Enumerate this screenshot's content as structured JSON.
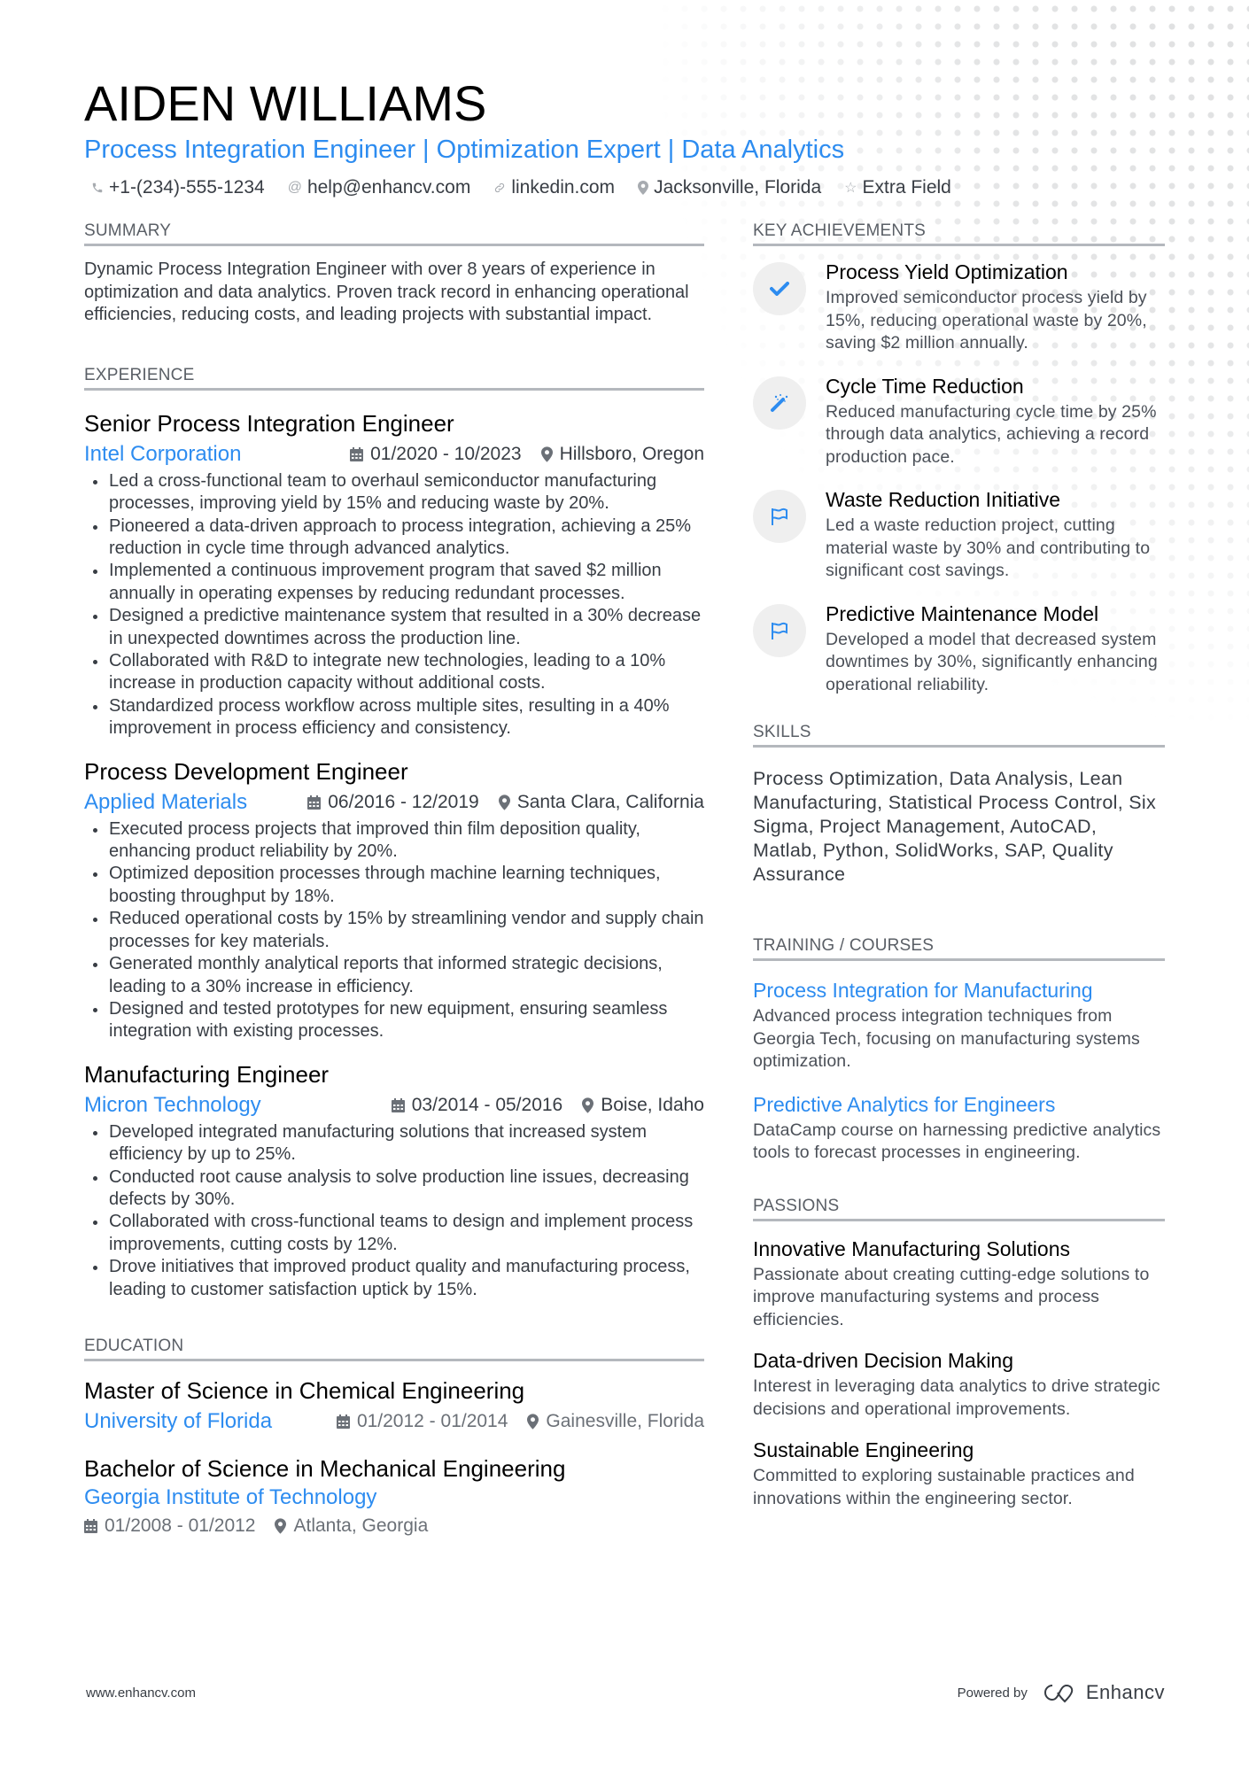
{
  "header": {
    "name": "AIDEN WILLIAMS",
    "headline": "Process Integration Engineer | Optimization Expert | Data Analytics",
    "contacts": [
      {
        "icon": "phone-icon",
        "text": "+1-(234)-555-1234"
      },
      {
        "icon": "at-icon",
        "text": "help@enhancv.com"
      },
      {
        "icon": "link-icon",
        "text": "linkedin.com"
      },
      {
        "icon": "location-pin-icon",
        "text": "Jacksonville, Florida"
      },
      {
        "icon": "star-icon",
        "text": "Extra Field"
      }
    ]
  },
  "summary": {
    "title": "SUMMARY",
    "text": "Dynamic Process Integration Engineer with over 8 years of experience in optimization and data analytics. Proven track record in enhancing operational efficiencies, reducing costs, and leading projects with substantial impact."
  },
  "experience": {
    "title": "EXPERIENCE",
    "items": [
      {
        "role": "Senior Process Integration Engineer",
        "company": "Intel Corporation",
        "dates": "01/2020 - 10/2023",
        "location": "Hillsboro, Oregon",
        "bullets": [
          "Led a cross-functional team to overhaul semiconductor manufacturing processes, improving yield by 15% and reducing waste by 20%.",
          "Pioneered a data-driven approach to process integration, achieving a 25% reduction in cycle time through advanced analytics.",
          "Implemented a continuous improvement program that saved $2 million annually in operating expenses by reducing redundant processes.",
          "Designed a predictive maintenance system that resulted in a 30% decrease in unexpected downtimes across the production line.",
          "Collaborated with R&D to integrate new technologies, leading to a 10% increase in production capacity without additional costs.",
          "Standardized process workflow across multiple sites, resulting in a 40% improvement in process efficiency and consistency."
        ]
      },
      {
        "role": "Process Development Engineer",
        "company": "Applied Materials",
        "dates": "06/2016 - 12/2019",
        "location": "Santa Clara, California",
        "bullets": [
          "Executed process projects that improved thin film deposition quality, enhancing product reliability by 20%.",
          "Optimized deposition processes through machine learning techniques, boosting throughput by 18%.",
          "Reduced operational costs by 15% by streamlining vendor and supply chain processes for key materials.",
          "Generated monthly analytical reports that informed strategic decisions, leading to a 30% increase in efficiency.",
          "Designed and tested prototypes for new equipment, ensuring seamless integration with existing processes."
        ]
      },
      {
        "role": "Manufacturing Engineer",
        "company": "Micron Technology",
        "dates": "03/2014 - 05/2016",
        "location": "Boise, Idaho",
        "bullets": [
          "Developed integrated manufacturing solutions that increased system efficiency by up to 25%.",
          "Conducted root cause analysis to solve production line issues, decreasing defects by 30%.",
          "Collaborated with cross-functional teams to design and implement process improvements, cutting costs by 12%.",
          "Drove initiatives that improved product quality and manufacturing process, leading to customer satisfaction uptick by 15%."
        ]
      }
    ]
  },
  "education": {
    "title": "EDUCATION",
    "items": [
      {
        "degree": "Master of Science in Chemical Engineering",
        "school": "University of Florida",
        "dates": "01/2012 - 01/2014",
        "location": "Gainesville, Florida"
      },
      {
        "degree": "Bachelor of Science in Mechanical Engineering",
        "school": "Georgia Institute of Technology",
        "dates": "01/2008 - 01/2012",
        "location": "Atlanta, Georgia"
      }
    ]
  },
  "achievements": {
    "title": "KEY ACHIEVEMENTS",
    "items": [
      {
        "icon": "checkmark-icon",
        "title": "Process Yield Optimization",
        "desc": "Improved semiconductor process yield by 15%, reducing operational waste by 20%, saving $2 million annually."
      },
      {
        "icon": "magic-wand-icon",
        "title": "Cycle Time Reduction",
        "desc": "Reduced manufacturing cycle time by 25% through data analytics, achieving a record production pace."
      },
      {
        "icon": "flag-icon",
        "title": "Waste Reduction Initiative",
        "desc": "Led a waste reduction project, cutting material waste by 30% and contributing to significant cost savings."
      },
      {
        "icon": "flag-icon",
        "title": "Predictive Maintenance Model",
        "desc": "Developed a model that decreased system downtimes by 30%, significantly enhancing operational reliability."
      }
    ]
  },
  "skills": {
    "title": "SKILLS",
    "text": "Process Optimization, Data Analysis, Lean Manufacturing, Statistical Process Control, Six Sigma, Project Management, AutoCAD, Matlab, Python, SolidWorks, SAP, Quality Assurance"
  },
  "training": {
    "title": "TRAINING / COURSES",
    "items": [
      {
        "title": "Process Integration for Manufacturing",
        "desc": "Advanced process integration techniques from Georgia Tech, focusing on manufacturing systems optimization."
      },
      {
        "title": "Predictive Analytics for Engineers",
        "desc": "DataCamp course on harnessing predictive analytics tools to forecast processes in engineering."
      }
    ]
  },
  "passions": {
    "title": "PASSIONS",
    "items": [
      {
        "title": "Innovative Manufacturing Solutions",
        "desc": "Passionate about creating cutting-edge solutions to improve manufacturing systems and process efficiencies."
      },
      {
        "title": "Data-driven Decision Making",
        "desc": "Interest in leveraging data analytics to drive strategic decisions and operational improvements."
      },
      {
        "title": "Sustainable Engineering",
        "desc": "Committed to exploring sustainable practices and innovations within the engineering sector."
      }
    ]
  },
  "footer": {
    "url": "www.enhancv.com",
    "powered_by": "Powered by",
    "brand": "Enhancv"
  },
  "colors": {
    "accent": "#2d8cf0",
    "text": "#383d44",
    "rule": "#b4b8bd",
    "icon_bg": "#efefef"
  }
}
